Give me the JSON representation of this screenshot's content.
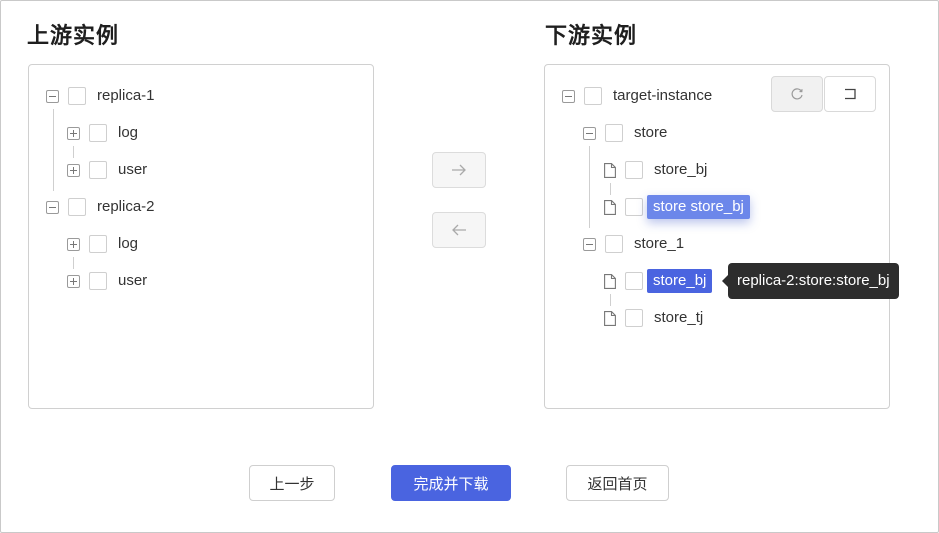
{
  "left_panel": {
    "title": "上游实例",
    "tree": [
      {
        "label": "replica-1",
        "children": [
          "log",
          "user"
        ]
      },
      {
        "label": "replica-2",
        "children": [
          "log",
          "user"
        ]
      }
    ]
  },
  "right_panel": {
    "title": "下游实例",
    "root_label": "target-instance",
    "groups": [
      {
        "label": "store",
        "children": [
          "store_bj",
          "store store_bj"
        ]
      },
      {
        "label": "store_1",
        "children": [
          "store_bj",
          "store_tj"
        ]
      }
    ],
    "tooltip": "replica-2:store:store_bj"
  },
  "transfer": {
    "move_right_icon": "arrow-right-icon",
    "move_left_icon": "arrow-left-icon"
  },
  "toolbar": {
    "refresh_icon": "refresh-icon",
    "undo_icon": "undo-icon"
  },
  "footer": {
    "prev_label": "上一步",
    "finish_label": "完成并下载",
    "home_label": "返回首页"
  },
  "colors": {
    "primary": "#4a64e0",
    "tooltip_bg": "#2d2d2d"
  }
}
